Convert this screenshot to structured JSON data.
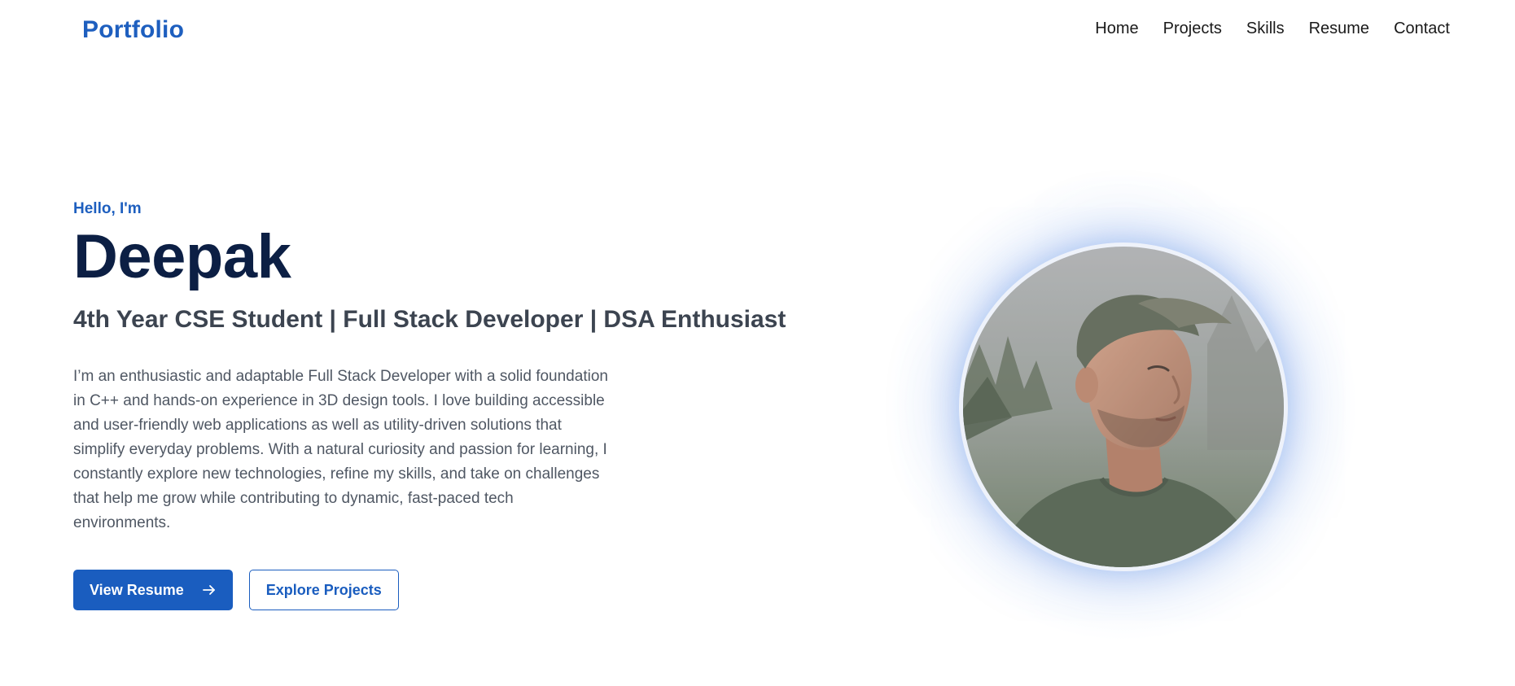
{
  "nav": {
    "brand": "Portfolio",
    "links": [
      "Home",
      "Projects",
      "Skills",
      "Resume",
      "Contact"
    ]
  },
  "hero": {
    "greeting": "Hello, I'm",
    "name": "Deepak",
    "tagline": "4th Year CSE Student | Full Stack Developer | DSA Enthusiast",
    "bio": "I’m an enthusiastic and adaptable Full Stack Developer with a solid foundation in C++ and hands-on experience in 3D design tools. I love building accessible and user-friendly web applications as well as utility-driven solutions that simplify everyday problems. With a natural curiosity and passion for learning, I constantly explore new technologies, refine my skills, and take on challenges that help me grow while contributing to dynamic, fast-paced tech environments.",
    "primary_button": "View Resume",
    "secondary_button": "Explore Projects",
    "primary_button_icon": "arrow-right-icon"
  },
  "colors": {
    "accent": "#1e5fbf",
    "heading": "#0c1f44",
    "body_text": "#4f5763"
  }
}
